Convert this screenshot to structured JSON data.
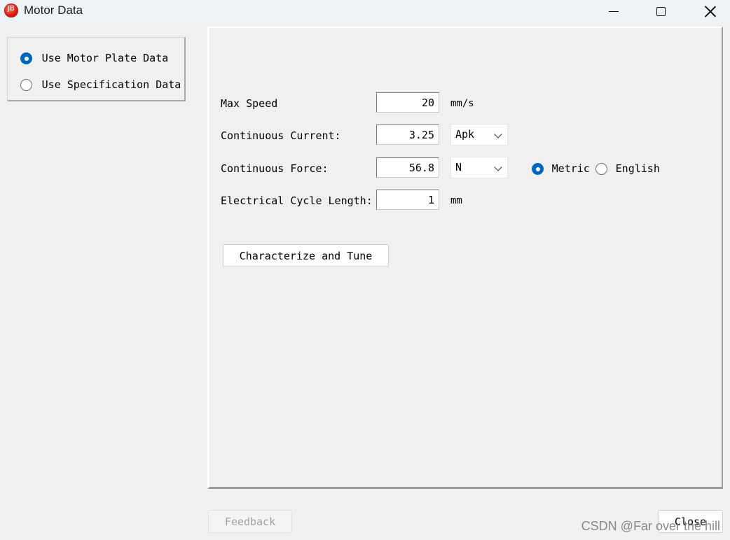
{
  "window": {
    "title": "Motor Data",
    "icon": "app-logo-icon",
    "controls": [
      "minimize-icon",
      "maximize-icon",
      "close-icon"
    ]
  },
  "data_source": {
    "options": [
      {
        "label": "Use Motor Plate Data",
        "selected": true
      },
      {
        "label": "Use Specification Data",
        "selected": false
      }
    ]
  },
  "form": {
    "max_speed": {
      "label": "Max Speed",
      "value": "20",
      "unit": "mm/s"
    },
    "continuous_current": {
      "label": "Continuous Current:",
      "value": "3.25",
      "unit": "Apk"
    },
    "continuous_force": {
      "label": "Continuous Force:",
      "value": "56.8",
      "unit": "N"
    },
    "electrical_cycle_length": {
      "label": "Electrical Cycle Length:",
      "value": "1",
      "unit": "mm"
    },
    "unit_system": {
      "options": [
        {
          "label": "Metric",
          "selected": true
        },
        {
          "label": "English",
          "selected": false
        }
      ]
    },
    "characterize_button": "Characterize and Tune"
  },
  "footer": {
    "feedback_button": "Feedback",
    "close_button": "Close",
    "watermark": "CSDN @Far over the hill"
  },
  "colors": {
    "accent": "#0067c0",
    "background": "#f0f0f0",
    "titlebar": "#eef3f8"
  }
}
